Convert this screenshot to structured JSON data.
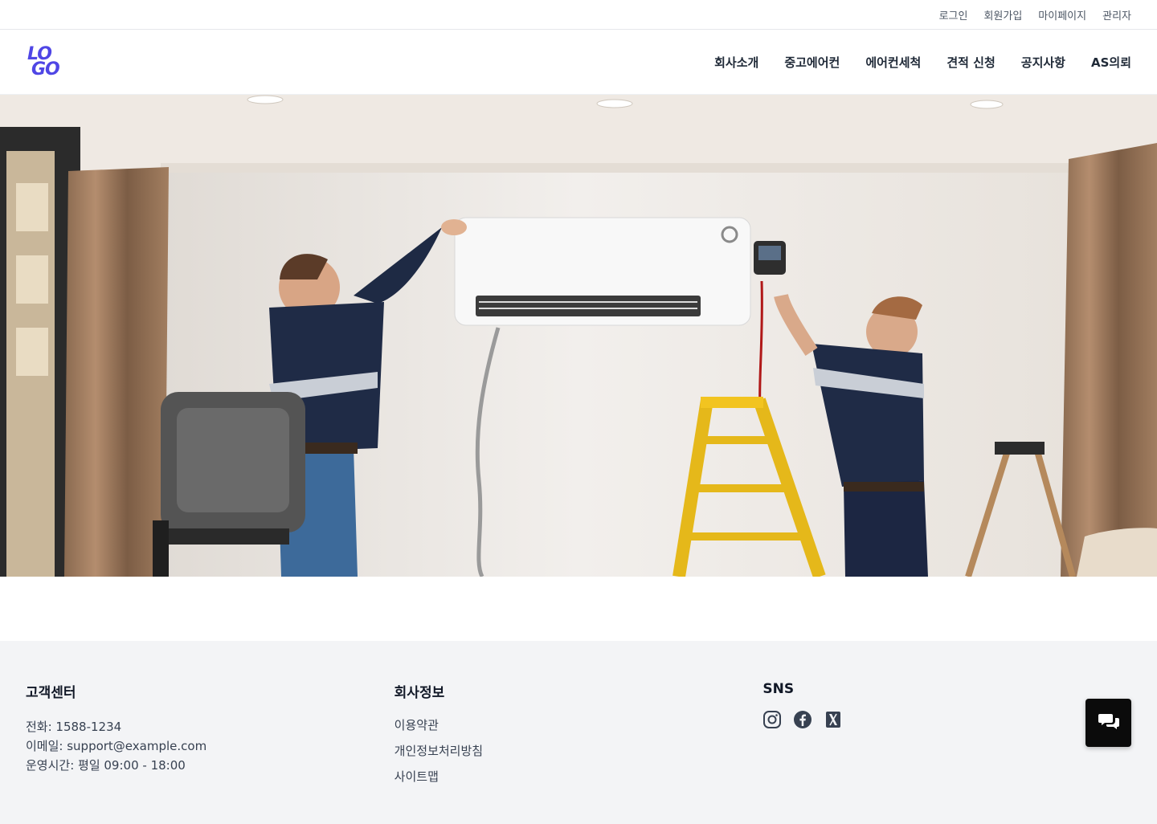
{
  "topbar": {
    "links": [
      "로그인",
      "회원가입",
      "마이페이지",
      "관리자"
    ]
  },
  "header": {
    "logo_line1": "LO",
    "logo_line2": "GO",
    "nav": [
      "회사소개",
      "중고에어컨",
      "에어컨세척",
      "견적 신청",
      "공지사항",
      "AS의뢰"
    ]
  },
  "hero": {
    "image": "technicians-installing-wall-air-conditioner",
    "slides": 3,
    "active_slide": 1
  },
  "footer": {
    "customer_center": {
      "title": "고객센터",
      "phone": "전화: 1588-1234",
      "email": "이메일: support@example.com",
      "hours": "운영시간: 평일 09:00 - 18:00"
    },
    "company_info": {
      "title": "회사정보",
      "links": [
        "이용약관",
        "개인정보처리방침",
        "사이트맵"
      ]
    },
    "sns": {
      "title": "SNS",
      "icons": [
        "instagram-icon",
        "facebook-icon",
        "x-twitter-icon"
      ]
    }
  },
  "colors": {
    "brand": "#4f46e5",
    "footer_bg": "#f3f4f6",
    "chat_button": "#0b0b0b"
  }
}
